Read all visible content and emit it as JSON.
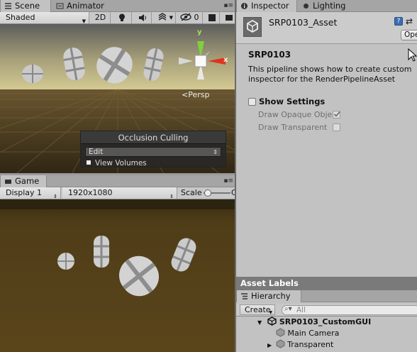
{
  "scene": {
    "tabs": [
      {
        "label": "Scene"
      },
      {
        "label": "Animator"
      }
    ],
    "toolbar": {
      "shading": "Shaded",
      "mode_2d": "2D",
      "gizmo_count": "0"
    },
    "persp_label": "<Persp",
    "axis_labels": {
      "y": "y",
      "x": "x"
    },
    "occlusion": {
      "title": "Occlusion Culling",
      "select_value": "Edit",
      "view_volumes": "View Volumes"
    }
  },
  "game": {
    "tab": "Game",
    "toolbar": {
      "display": "Display 1",
      "resolution": "1920x1080",
      "scale_label": "Scale",
      "scale_value": "C"
    }
  },
  "inspector": {
    "tabs": [
      {
        "label": "Inspector"
      },
      {
        "label": "Lighting"
      }
    ],
    "asset_name": "SRP0103_Asset",
    "open_button": "Ope",
    "heading": "SRP0103",
    "description_line1": "This pipeline shows how to create custom",
    "description_line2": "inspector for the RenderPipelineAsset",
    "show_settings": "Show Settings",
    "draw_opaque": "Draw Opaque Obje",
    "draw_opaque_checked": true,
    "draw_transparent": "Draw Transparent",
    "draw_transparent_checked": false
  },
  "asset_labels": "Asset Labels",
  "hierarchy": {
    "tab": "Hierarchy",
    "create": "Create",
    "search_placeholder": "All",
    "scene_name": "SRP0103_CustomGUI",
    "items": [
      {
        "label": "Main Camera"
      },
      {
        "label": "Transparent"
      }
    ]
  },
  "colors": {
    "sky_top": "#5a5a58",
    "horizon": "#c9c08a",
    "ground": "#4a3a1c",
    "game_bg": "#4f3c16",
    "panel": "#c2c2c2"
  }
}
